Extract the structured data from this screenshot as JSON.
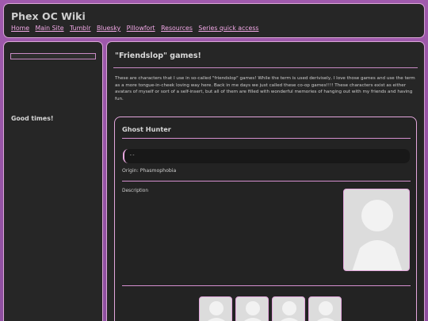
{
  "header": {
    "title": "Phex OC Wiki",
    "nav": [
      "Home",
      "Main Site",
      "Tumblr",
      "Bluesky",
      "Pillowfort",
      "Resources",
      "Series quick access"
    ]
  },
  "sidebar": {
    "tagline": "Good times!"
  },
  "main": {
    "title": "\"Friendslop\" games!",
    "intro": "These are characters that I use in so-called \"friendslop\" games! While the term is used derivisely, I love those games and use the term as a more tongue-in-cheek loving way here. Back in me days we just called these co-op games!!!! These characters exist as either avatars of myself or sort of a self-insert, but all of them are filled with wonderful memories of hanging out with my friends and having fun.",
    "card": {
      "name": "Ghost Hunter",
      "code": "--",
      "origin": "Origin: Phasmophobia",
      "description_label": "Description",
      "portrait_icon": "person-silhouette-icon",
      "thumbnail_icon": "person-silhouette-icon",
      "thumbnail_count": 4
    }
  },
  "colors": {
    "background": "#9b59b6",
    "panel": "#262626",
    "border": "#d9a6d6",
    "link": "#f2a8e6"
  }
}
